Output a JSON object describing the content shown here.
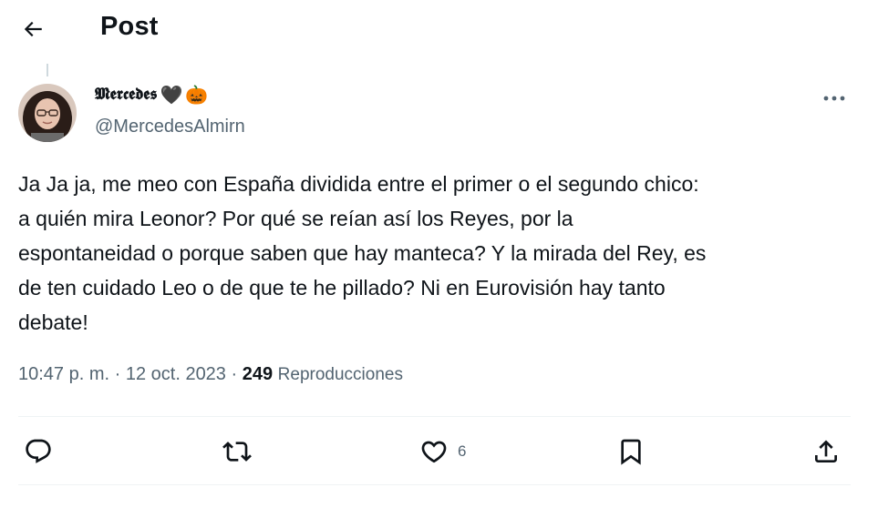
{
  "header": {
    "title": "Post"
  },
  "author": {
    "display_name": "𝕸𝖊𝖗𝖈𝖊𝖉𝖊𝖘",
    "emojis": [
      "🖤",
      "🎃"
    ],
    "handle": "@MercedesAlmirn"
  },
  "tweet": {
    "text": "Ja Ja ja, me meo con España dividida entre el primer o el segundo chico:\na quién mira Leonor? Por qué se reían así los Reyes, por la\nespontaneidad o porque saben que hay manteca? Y la mirada del Rey, es\nde ten cuidado Leo o de que te he pillado? Ni en Eurovisión hay tanto\ndebate!",
    "time": "10:47 p. m.",
    "separator": " · ",
    "date": "12 oct. 2023",
    "views_count": "249",
    "views_label": "Reproducciones"
  },
  "actions": {
    "reply": {
      "icon": "reply-icon",
      "count": ""
    },
    "repost": {
      "icon": "repost-icon",
      "count": ""
    },
    "like": {
      "icon": "heart-icon",
      "count": "6"
    },
    "bookmark": {
      "icon": "bookmark-icon",
      "count": ""
    },
    "share": {
      "icon": "share-icon",
      "count": ""
    }
  },
  "colors": {
    "text": "#0f1419",
    "secondary": "#536471",
    "divider": "#eff3f4"
  }
}
